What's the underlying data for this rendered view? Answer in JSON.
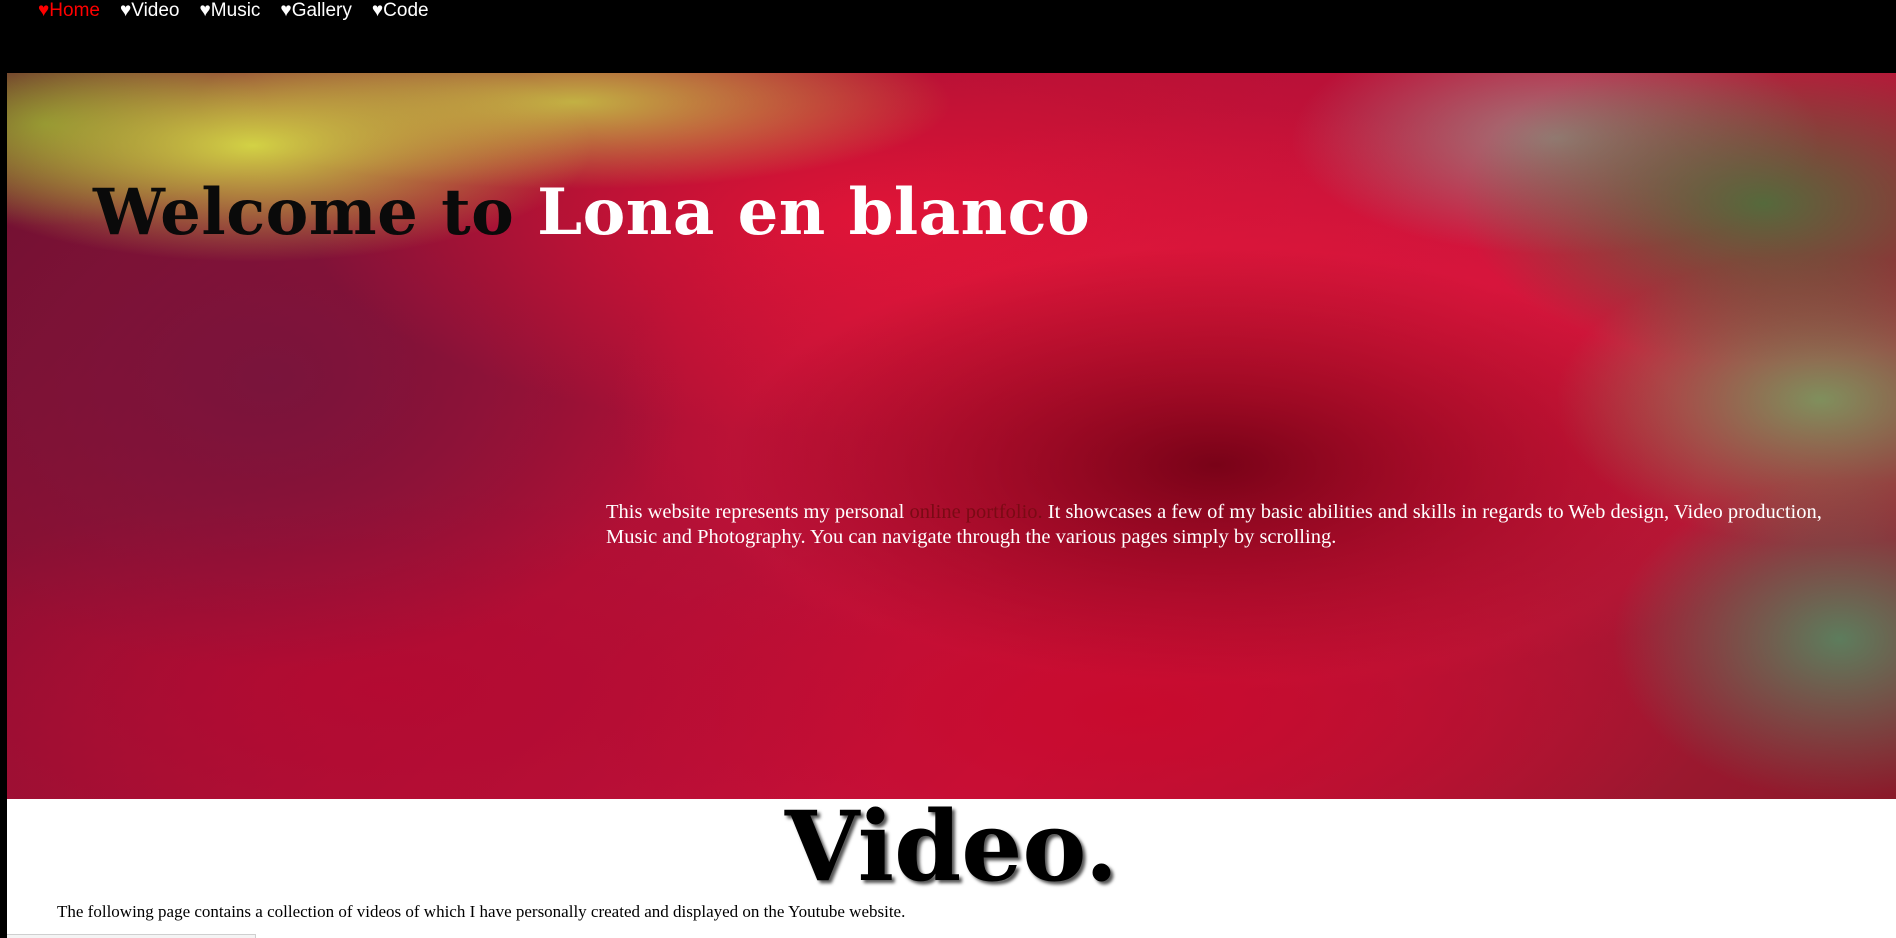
{
  "nav": {
    "items": [
      {
        "label": "♥Home",
        "active": true
      },
      {
        "label": "♥Video",
        "active": false
      },
      {
        "label": "♥Music",
        "active": false
      },
      {
        "label": "♥Gallery",
        "active": false
      },
      {
        "label": "♥Code",
        "active": false
      }
    ]
  },
  "hero": {
    "title_part1": "Welcome to ",
    "title_part2": "Lona en blanco",
    "intro_before": "This website represents my personal ",
    "intro_link": "online portfolio.",
    "intro_after": " It showcases a few of my basic abilities and skills in regards to Web design, Video production, Music and Photography. You can navigate through the various pages simply by scrolling.",
    "background_image": "red rose photograph"
  },
  "video": {
    "heading": "Video.",
    "description": "The following page contains a collection of videos of which I have personally created and displayed on the Youtube website."
  },
  "colors": {
    "nav_background": "#000000",
    "nav_text": "#ffffff",
    "nav_active": "#ff0000",
    "link_dark_red": "#7a0a14"
  }
}
